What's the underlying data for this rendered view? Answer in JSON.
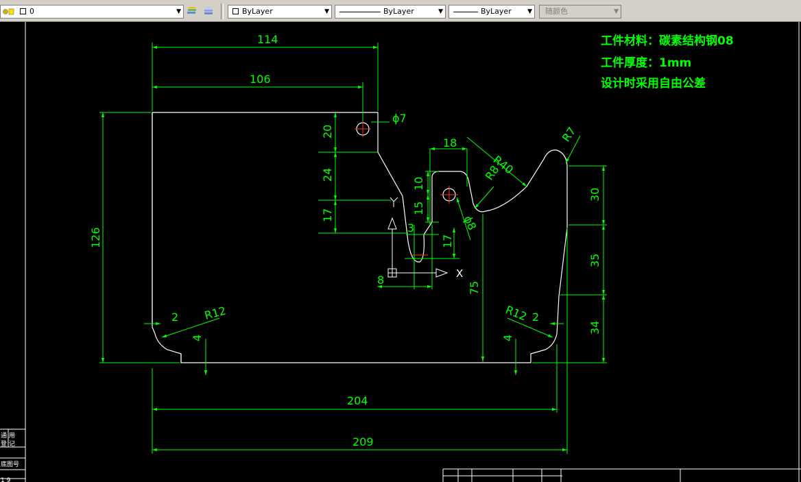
{
  "toolbar": {
    "layer_value": "0",
    "color_value": "ByLayer",
    "linetype_value": "ByLayer",
    "lineweight_value": "ByLayer",
    "plotstyle_value": "随颜色"
  },
  "notes": {
    "material": "工件材料：碳素结构钢08",
    "thickness": "工件厚度：1mm",
    "tolerance": "设计时采用自由公差"
  },
  "dimensions": {
    "d114": "114",
    "d106": "106",
    "d126": "126",
    "d20": "20",
    "d24": "24",
    "d17_left": "17",
    "phi7": "ϕ7",
    "d18": "18",
    "r40": "R40",
    "r7": "R7",
    "r8": "R8",
    "d10": "10",
    "d15": "15",
    "d3": "3",
    "d17_mid": "17",
    "phi8": "ϕ8",
    "d8": "8",
    "d75": "75",
    "d30": "30",
    "d35": "35",
    "d34": "34",
    "d2_left": "2",
    "r12_left": "R12",
    "d4_left": "4",
    "r12_right": "R12",
    "d2_right": "2",
    "d4_right": "4",
    "d204": "204",
    "d209": "209"
  },
  "ucs": {
    "x_label": "X",
    "y_label": "Y"
  },
  "sidebar": {
    "text1": "通 用",
    "text2": "登 记",
    "text3": "底图号",
    "text4": "1 9"
  },
  "colors": {
    "canvas": "#000000",
    "geometry": "#ffffff",
    "dimension": "#00ff00",
    "centerline": "#ff0000"
  }
}
